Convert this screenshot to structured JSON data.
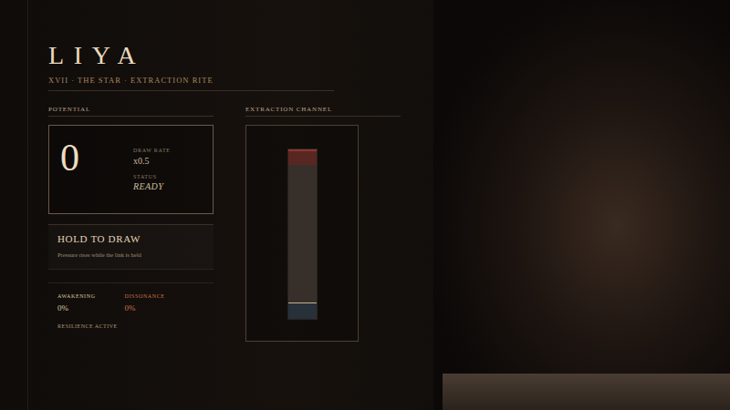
{
  "character": {
    "name": "LIYA",
    "subtitle": "XVII · THE STAR · EXTRACTION RITE"
  },
  "potential": {
    "label": "POTENTIAL",
    "value": "0",
    "stats": [
      {
        "label": "DRAW RATE",
        "value": "x0.5",
        "kind": "plain"
      },
      {
        "label": "STATUS",
        "value": "READY",
        "kind": "italic"
      }
    ]
  },
  "action": {
    "title": "HOLD TO DRAW",
    "hint": "Pressure rises while the link is held"
  },
  "meters": [
    {
      "label": "AWAKENING",
      "value": "0%",
      "color": "#d8c3a0"
    },
    {
      "label": "DISSONANCE",
      "value": "0%",
      "color": "#c8704c"
    }
  ],
  "resilience": {
    "label": "RESILIENCE ACTIVE"
  },
  "channel": {
    "label": "EXTRACTION CHANNEL",
    "level": 0
  }
}
